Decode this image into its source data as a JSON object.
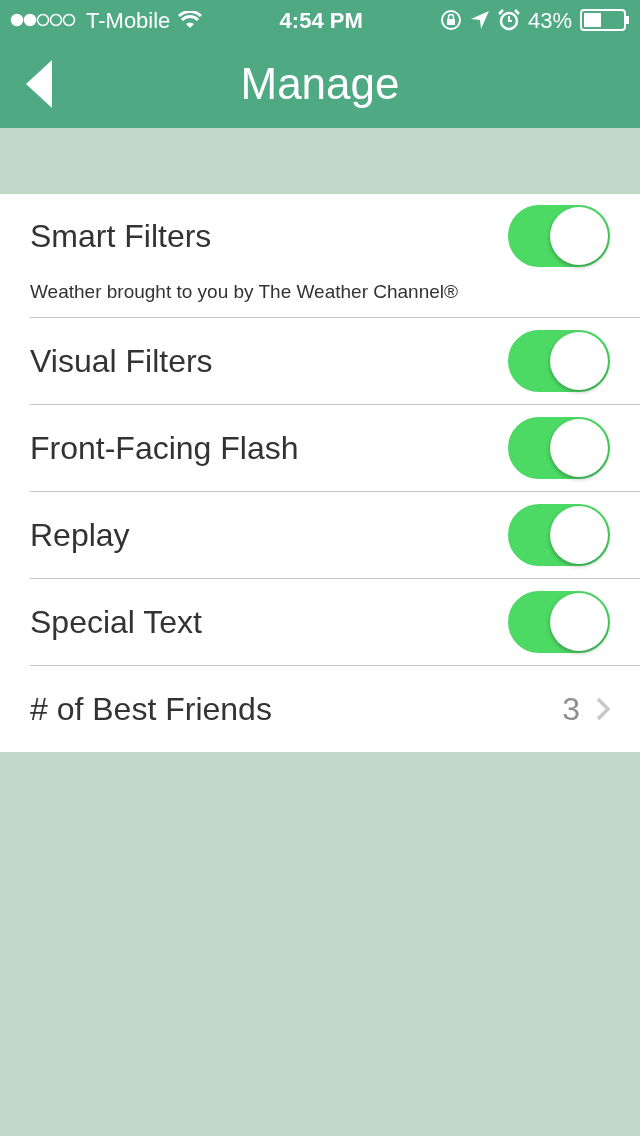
{
  "status_bar": {
    "carrier": "T-Mobile",
    "time": "4:54 PM",
    "battery": "43%"
  },
  "nav": {
    "title": "Manage"
  },
  "settings": [
    {
      "kind": "toggle",
      "label": "Smart Filters",
      "note": "Weather brought to you by The Weather Channel®",
      "on": true
    },
    {
      "kind": "toggle",
      "label": "Visual Filters",
      "on": true
    },
    {
      "kind": "toggle",
      "label": "Front-Facing Flash",
      "on": true
    },
    {
      "kind": "toggle",
      "label": "Replay",
      "on": true
    },
    {
      "kind": "toggle",
      "label": "Special Text",
      "on": true
    },
    {
      "kind": "value",
      "label": "# of Best Friends",
      "value": "3"
    }
  ]
}
